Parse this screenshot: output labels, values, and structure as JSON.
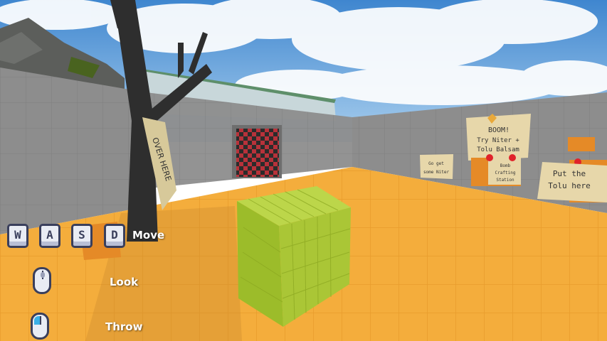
{
  "scene": {
    "signs": {
      "boom_title": "BOOM!",
      "boom_line1": "Try Niter +",
      "boom_line2": "Tolu Balsam",
      "put_line1": "Put the",
      "put_line2": "Tolu here",
      "small_line1": "Go get",
      "small_line2": "some Niter",
      "station_line1": "Bomb",
      "station_line2": "Crafting",
      "station_line3": "Station",
      "tree_sign": "OVER HERE"
    }
  },
  "controls": {
    "move": {
      "keys": [
        "W",
        "A",
        "S",
        "D"
      ],
      "label": "Move"
    },
    "look": {
      "icon": "mouse-icon",
      "label": "Look"
    },
    "throw": {
      "icon": "mouse-left-click-icon",
      "label": "Throw"
    }
  }
}
